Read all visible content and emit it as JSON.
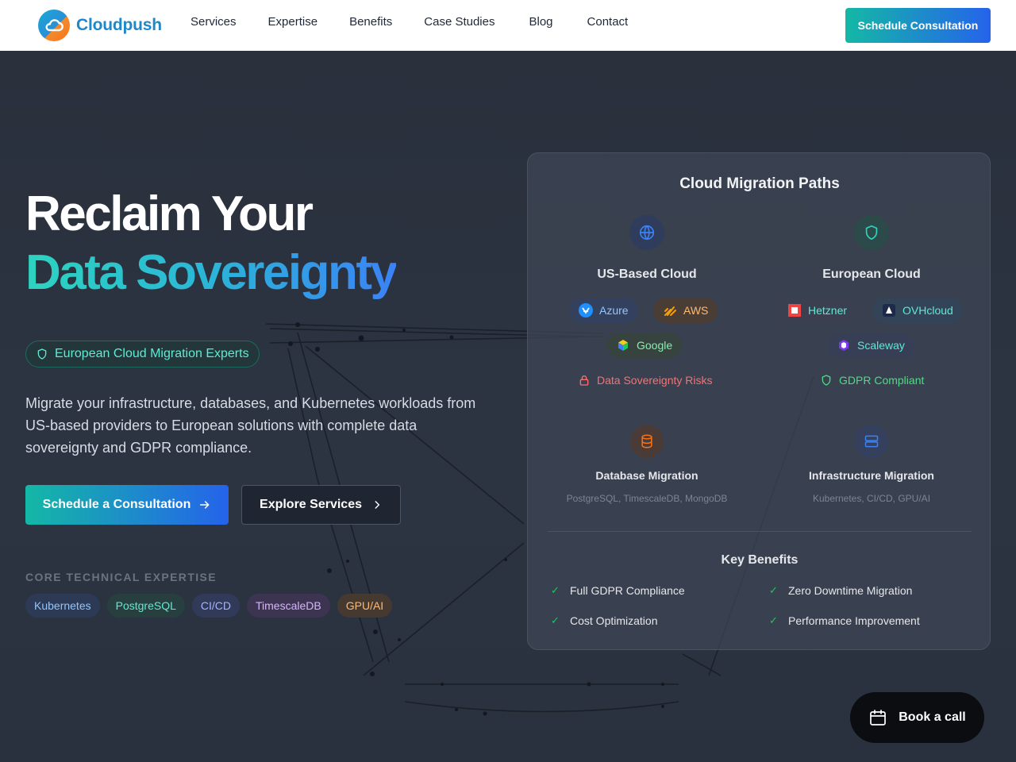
{
  "nav": {
    "brand": "Cloudpush",
    "links": [
      "Services",
      "Expertise",
      "Benefits",
      "Case Studies",
      "Blog",
      "Contact"
    ],
    "cta": "Schedule Consultation"
  },
  "hero": {
    "title_line1": "Reclaim Your",
    "title_line2": "Data Sovereignty",
    "badge": "European Cloud Migration Experts",
    "lead": "Migrate your infrastructure, databases, and Kubernetes workloads from US-based providers to European solutions with complete data sovereignty and GDPR compliance.",
    "primary_button": "Schedule a Consultation",
    "secondary_button": "Explore Services",
    "expertise_title": "CORE TECHNICAL EXPERTISE",
    "expertise_chips": [
      "Kubernetes",
      "PostgreSQL",
      "CI/CD",
      "TimescaleDB",
      "GPU/AI"
    ]
  },
  "card": {
    "title": "Cloud Migration Paths",
    "us": {
      "title": "US-Based Cloud",
      "providers": [
        "Azure",
        "AWS",
        "Google"
      ],
      "status": "Data Sovereignty Risks"
    },
    "eu": {
      "title": "European Cloud",
      "providers": [
        "Hetzner",
        "OVHcloud",
        "Scaleway"
      ],
      "status": "GDPR Compliant"
    },
    "db": {
      "title": "Database Migration",
      "subtitle": "PostgreSQL, TimescaleDB, MongoDB"
    },
    "infra": {
      "title": "Infrastructure Migration",
      "subtitle": "Kubernetes, CI/CD, GPU/AI"
    },
    "benefits_title": "Key Benefits",
    "benefits": [
      "Full GDPR Compliance",
      "Zero Downtime Migration",
      "Cost Optimization",
      "Performance Improvement"
    ]
  },
  "float_button": "Book a call",
  "colors": {
    "accent_teal": "#14b8a6",
    "accent_blue": "#2563eb",
    "background": "#2b3240",
    "success": "#22c55e",
    "danger": "#f87171"
  }
}
